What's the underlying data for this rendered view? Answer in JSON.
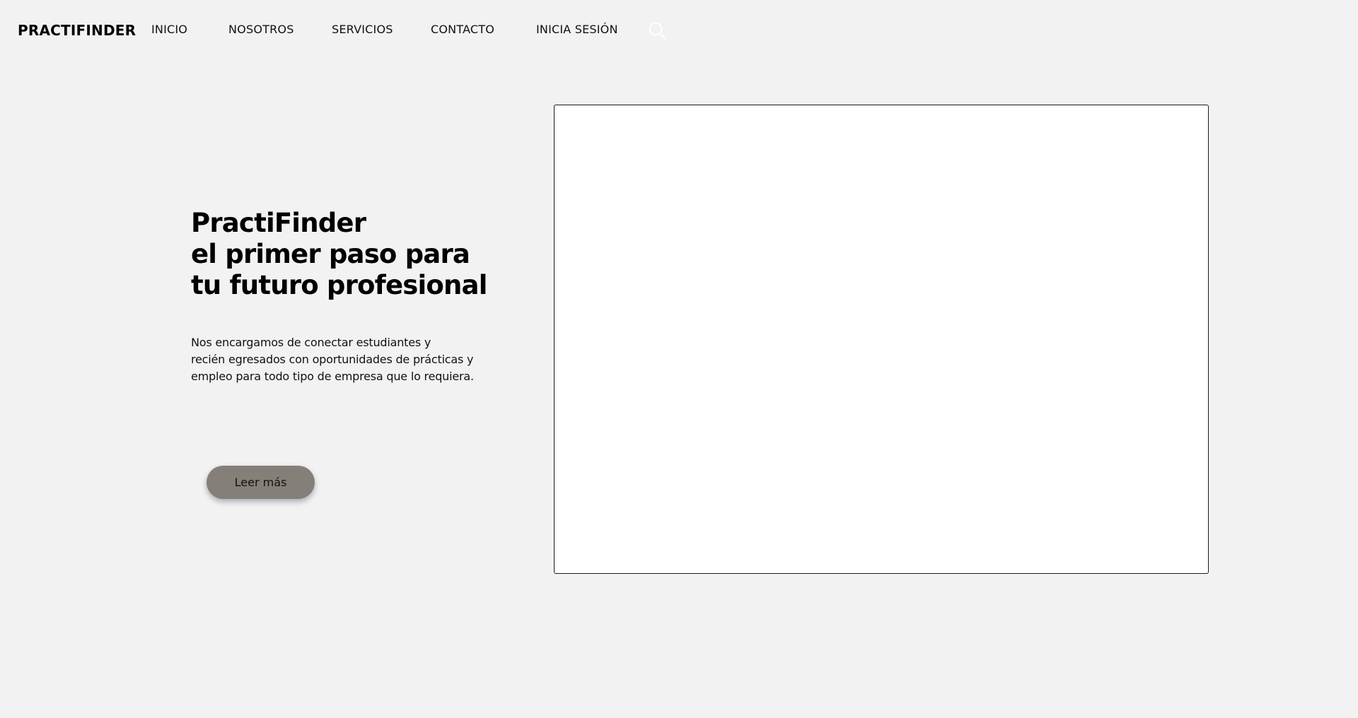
{
  "header": {
    "brand": "PRACTIFINDER",
    "nav": [
      {
        "label": "INICIO"
      },
      {
        "label": "NOSOTROS"
      },
      {
        "label": "SERVICIOS"
      },
      {
        "label": "CONTACTO"
      },
      {
        "label": "INICIA SESIÓN"
      }
    ],
    "search_icon": "search-icon"
  },
  "hero": {
    "title_lines": [
      "PractiFinder",
      "el primer paso para",
      "tu futuro profesional"
    ],
    "description_lines": [
      "Nos encargamos de conectar estudiantes y",
      "recién egresados con oportunidades de prácticas y",
      "empleo para todo tipo de empresa que lo requiera."
    ],
    "button_label": "Leer más"
  },
  "colors": {
    "background": "#f2f2f2",
    "button": "#848079",
    "media_frame": "#ffffff",
    "search_icon": "#ffffff"
  }
}
